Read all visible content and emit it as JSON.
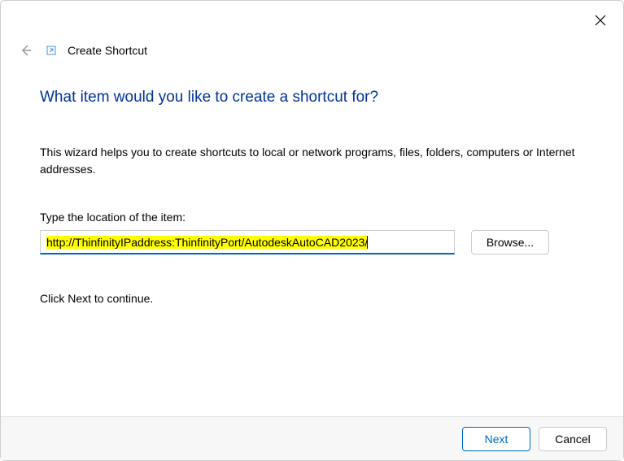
{
  "window": {
    "title": "Create Shortcut"
  },
  "content": {
    "heading": "What item would you like to create a shortcut for?",
    "description": "This wizard helps you to create shortcuts to local or network programs, files, folders, computers or Internet addresses.",
    "field_label": "Type the location of the item:",
    "location_value": "http://ThinfinityIPaddress:ThinfinityPort/AutodeskAutoCAD2023/",
    "browse_label": "Browse...",
    "continue_text": "Click Next to continue."
  },
  "footer": {
    "next_label": "Next",
    "cancel_label": "Cancel"
  }
}
